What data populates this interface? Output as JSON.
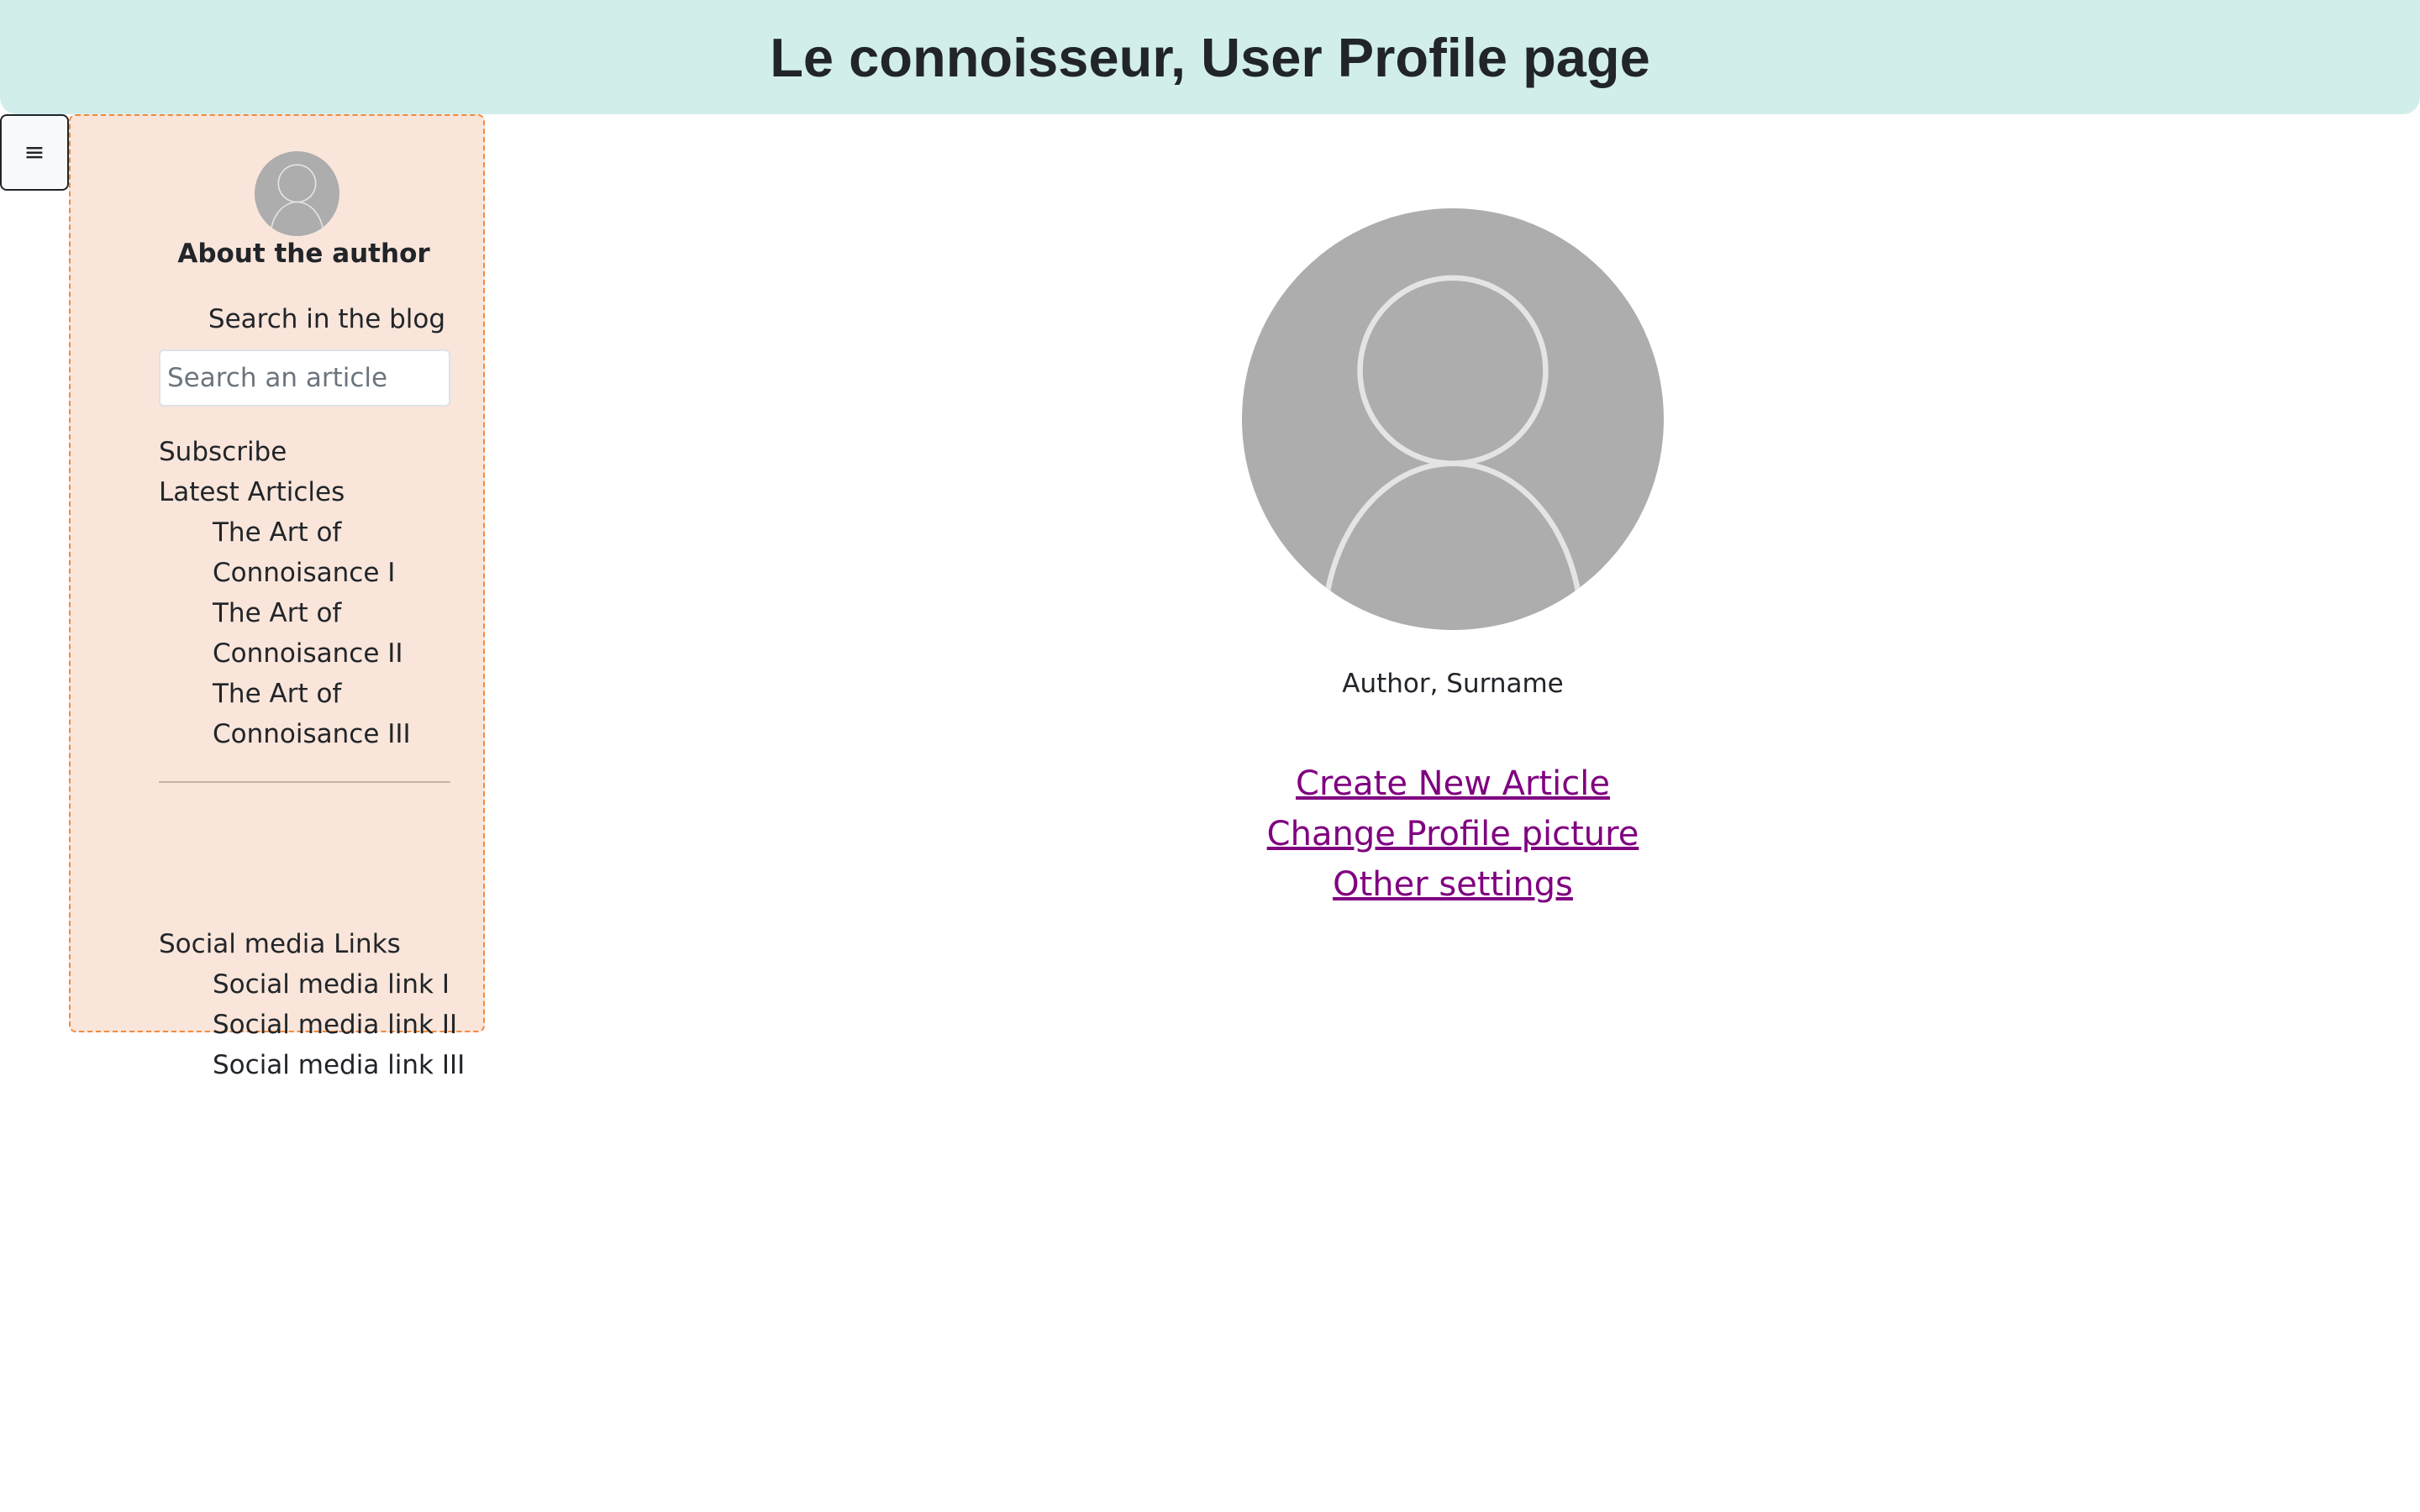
{
  "header": {
    "title": "Le connoisseur, User Profile page"
  },
  "toggle": {
    "icon": "menu-icon",
    "glyph": "≡"
  },
  "sidebar": {
    "avatar_icon": "user-avatar-icon",
    "about_title": "About the author",
    "search_label": "Search in the blog",
    "search_placeholder": "Search an article",
    "subscribe": "Subscribe",
    "latest_title": "Latest Articles",
    "articles": [
      {
        "line1": "The Art of",
        "line2": "Connoisance I"
      },
      {
        "line1": "The Art of",
        "line2": "Connoisance II"
      },
      {
        "line1": "The Art of",
        "line2": "Connoisance III"
      }
    ],
    "social_title": "Social media Links",
    "social_links": [
      "Social media link I",
      "Social media link II",
      "Social media link III"
    ]
  },
  "profile": {
    "avatar_icon": "user-avatar-icon",
    "name": "Author, Surname",
    "links": [
      "Create New Article",
      "Change Profile picture",
      "Other settings"
    ]
  },
  "colors": {
    "header_bg": "#d1eeeb",
    "sidebar_bg": "#f9e5da",
    "sidebar_border": "#f28a3d",
    "link": "#800080",
    "avatar": "#adadad"
  }
}
